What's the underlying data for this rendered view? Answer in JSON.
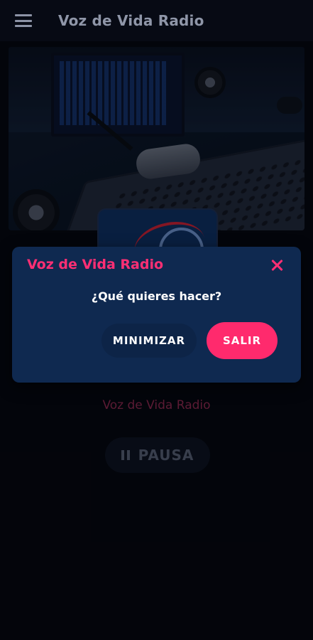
{
  "appbar": {
    "title": "Voz de Vida Radio",
    "menu_icon": "hamburger-menu-icon"
  },
  "player": {
    "station_name": "Voz de Vida Radio",
    "pause_label": "PAUSA",
    "pause_icon": "pause-icon"
  },
  "dialog": {
    "title": "Voz de Vida Radio",
    "message": "¿Qué quieres hacer?",
    "minimize_label": "MINIMIZAR",
    "exit_label": "SALIR",
    "close_icon": "close-icon"
  },
  "colors": {
    "accent": "#ff2a6d",
    "dialog_bg": "#0f2950",
    "background": "#05070f"
  }
}
